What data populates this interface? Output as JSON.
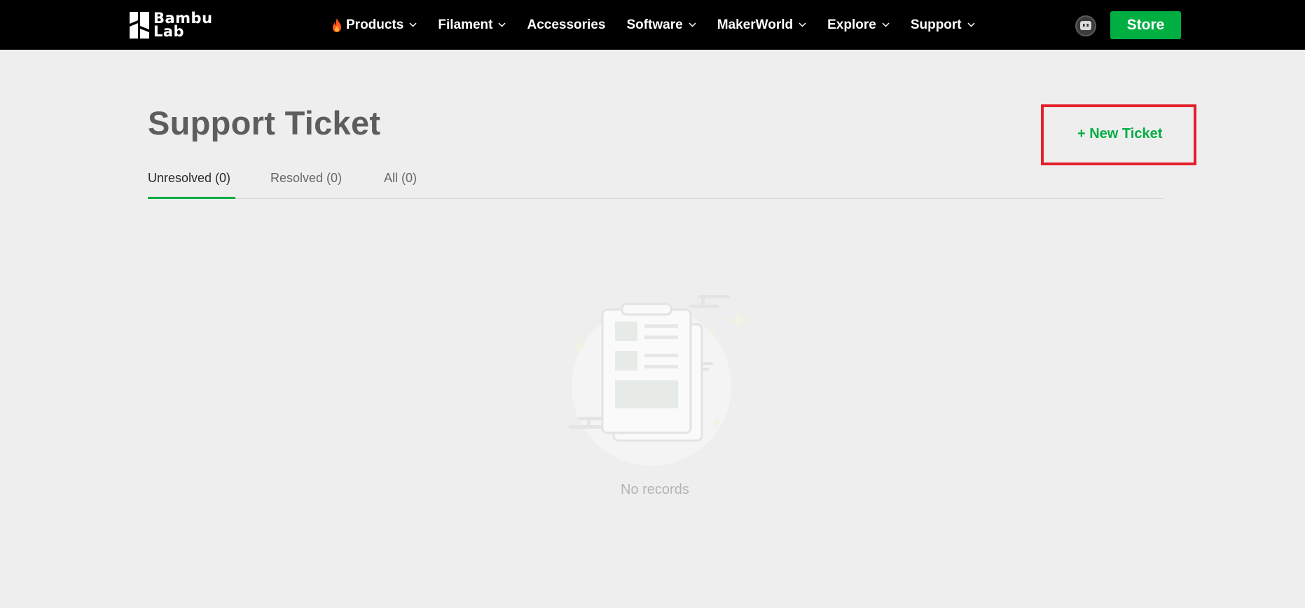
{
  "nav": {
    "logo_line1": "Bambu",
    "logo_line2": "Lab",
    "items": [
      {
        "label": "Products",
        "has_dropdown": true,
        "icon": "flame-icon"
      },
      {
        "label": "Filament",
        "has_dropdown": true
      },
      {
        "label": "Accessories",
        "has_dropdown": false
      },
      {
        "label": "Software",
        "has_dropdown": true
      },
      {
        "label": "MakerWorld",
        "has_dropdown": true
      },
      {
        "label": "Explore",
        "has_dropdown": true
      },
      {
        "label": "Support",
        "has_dropdown": true
      }
    ],
    "store_label": "Store"
  },
  "page": {
    "title": "Support Ticket",
    "new_ticket_label": "+ New Ticket",
    "tabs": [
      {
        "label": "Unresolved (0)",
        "active": true
      },
      {
        "label": "Resolved (0)",
        "active": false
      },
      {
        "label": "All (0)",
        "active": false
      }
    ],
    "empty_text": "No records"
  },
  "colors": {
    "brand_green": "#00ae42",
    "nav_bg": "#000000",
    "page_bg": "#eeeeee",
    "highlight_red": "#e3202b"
  }
}
